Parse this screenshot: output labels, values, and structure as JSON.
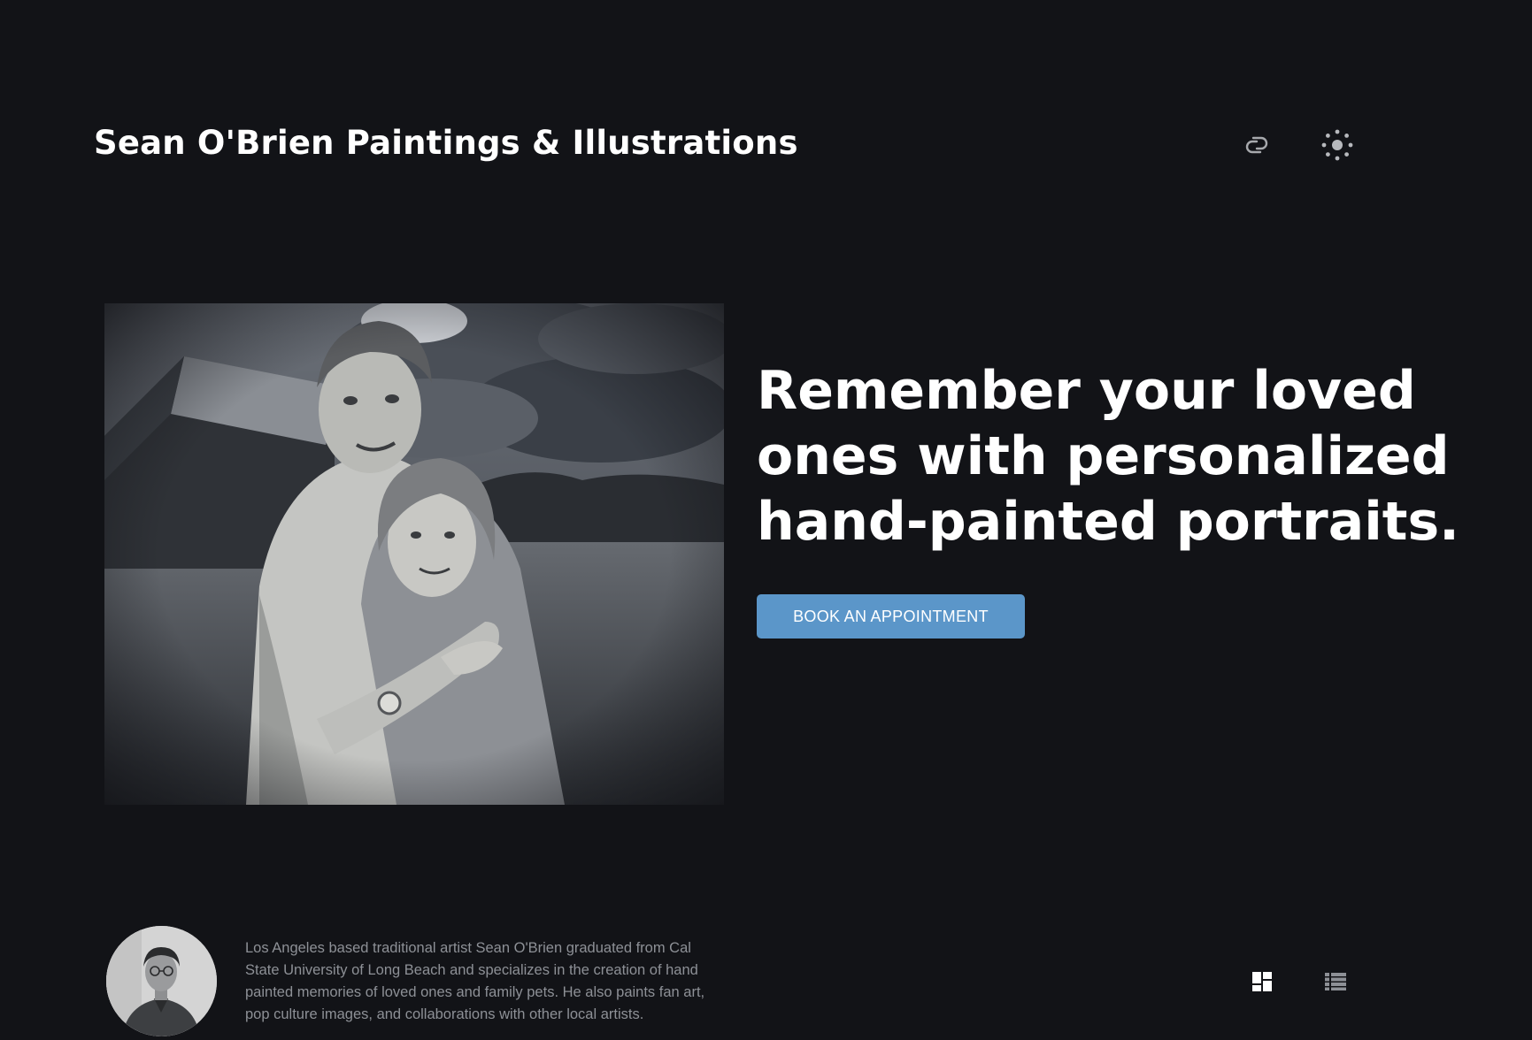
{
  "header": {
    "site_title": "Sean O'Brien Paintings & Illustrations",
    "icons": [
      "link-icon",
      "theme-toggle-icon"
    ]
  },
  "hero": {
    "image_icon": "portrait-painting",
    "heading": "Remember your loved ones with personalized hand-painted portraits.",
    "cta_label": "BOOK AN APPOINTMENT"
  },
  "about": {
    "avatar_icon": "artist-avatar",
    "bio": "Los Angeles based traditional artist Sean O'Brien graduated from Cal State University of Long Beach and specializes in the creation of hand painted memories of loved ones and family pets. He also paints fan art, pop culture images, and collaborations with other local artists."
  },
  "view_toggles": {
    "grid_icon": "grid-view-icon",
    "list_icon": "list-view-icon",
    "active": "grid"
  },
  "colors": {
    "background": "#121317",
    "text": "#ffffff",
    "muted_text": "#8d9096",
    "accent": "#5b96c9"
  }
}
